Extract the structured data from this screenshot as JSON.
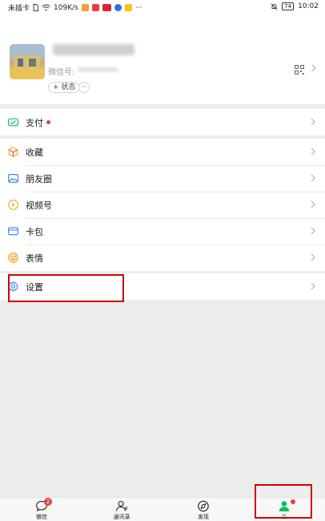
{
  "status_bar": {
    "carrier": "未插卡",
    "speed": "109K/s",
    "battery": "74",
    "time": "10:02"
  },
  "profile": {
    "wechat_id_label": "微信号:",
    "status_button": "+ 状态",
    "more_button": "···"
  },
  "menu": {
    "pay": "支付",
    "favorites": "收藏",
    "moments": "朋友圈",
    "channels": "视频号",
    "cards": "卡包",
    "stickers": "表情",
    "settings": "设置"
  },
  "tabbar": {
    "chats": "微信",
    "chats_badge": "2",
    "contacts": "通讯录",
    "discover": "发现",
    "me": "我"
  },
  "colors": {
    "accent": "#07c160",
    "highlight": "#d40000",
    "badge": "#e64340"
  }
}
